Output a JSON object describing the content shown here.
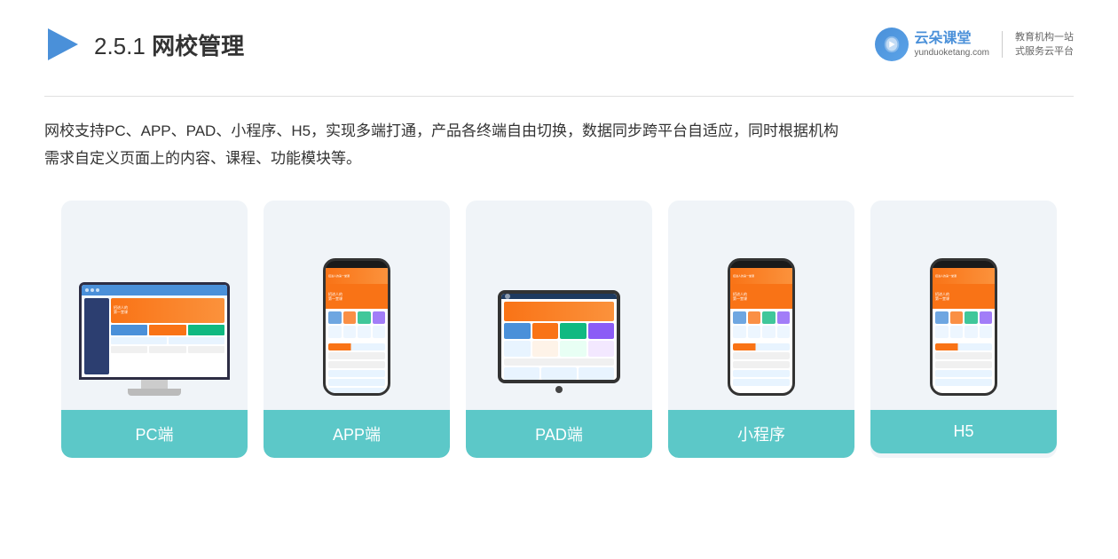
{
  "header": {
    "section_number": "2.5.1",
    "title_plain": "2.5.1 ",
    "title_bold": "网校管理",
    "logo": {
      "main": "云朵课堂",
      "url": "yunduoketang.com",
      "slogan_line1": "教育机构一站",
      "slogan_line2": "式服务云平台"
    }
  },
  "description": {
    "text_line1": "网校支持PC、APP、PAD、小程序、H5，实现多端打通，产品各终端自由切换，数据同步跨平台自适应，同时根据机构",
    "text_line2": "需求自定义页面上的内容、课程、功能模块等。"
  },
  "cards": [
    {
      "id": "pc",
      "label": "PC端",
      "type": "monitor"
    },
    {
      "id": "app",
      "label": "APP端",
      "type": "phone"
    },
    {
      "id": "pad",
      "label": "PAD端",
      "type": "tablet"
    },
    {
      "id": "miniapp",
      "label": "小程序",
      "type": "phone"
    },
    {
      "id": "h5",
      "label": "H5",
      "type": "phone"
    }
  ],
  "colors": {
    "accent": "#5cc8c8",
    "accent_hover": "#4ab8b8",
    "primary": "#4a90d9",
    "orange": "#f97316",
    "card_bg": "#eef3f8"
  }
}
